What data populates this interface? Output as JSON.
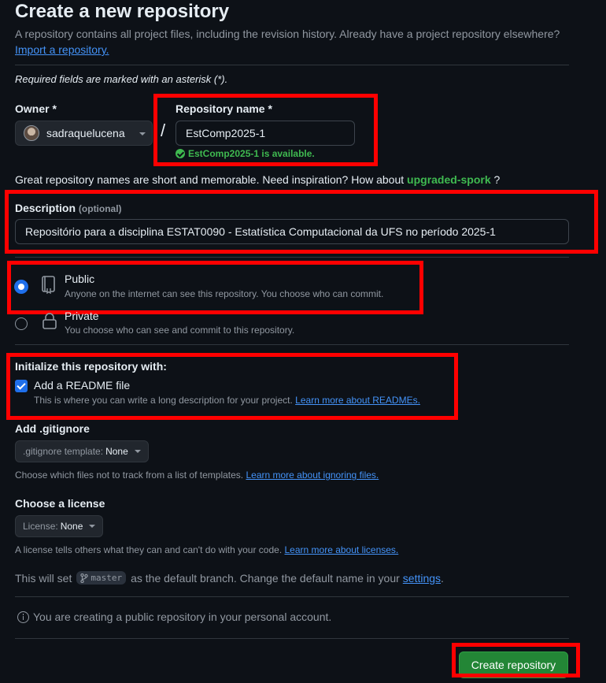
{
  "header": {
    "title": "Create a new repository",
    "subtitle": "A repository contains all project files, including the revision history. Already have a project repository elsewhere?",
    "import_link": "Import a repository."
  },
  "required_note": "Required fields are marked with an asterisk (*).",
  "owner": {
    "label": "Owner *",
    "value": "sadraquelucena",
    "avatar_icon": "user-avatar"
  },
  "separator": "/",
  "repo_name": {
    "label": "Repository name *",
    "value": "EstComp2025-1",
    "availability": "EstComp2025-1 is available.",
    "availability_color": "#3fb950"
  },
  "inspiration": {
    "text": "Great repository names are short and memorable. Need inspiration? How about",
    "suggestion": "upgraded-spork",
    "end": "?"
  },
  "description": {
    "label": "Description",
    "optional": "(optional)",
    "value": "Repositório para a disciplina ESTAT0090 - Estatística Computacional da UFS no período 2025-1"
  },
  "visibility": {
    "options": [
      {
        "label": "Public",
        "description": "Anyone on the internet can see this repository. You choose who can commit.",
        "icon": "repo-icon",
        "selected": true
      },
      {
        "label": "Private",
        "description": "You choose who can see and commit to this repository.",
        "icon": "lock-icon",
        "selected": false
      }
    ]
  },
  "initialize": {
    "heading": "Initialize this repository with:",
    "readme_label": "Add a README file",
    "readme_desc": "This is where you can write a long description for your project.",
    "readme_link": "Learn more about READMEs.",
    "readme_checked": true
  },
  "gitignore": {
    "heading": "Add .gitignore",
    "button_prefix": ".gitignore template:",
    "button_value": "None",
    "desc": "Choose which files not to track from a list of templates.",
    "link": "Learn more about ignoring files."
  },
  "license": {
    "heading": "Choose a license",
    "button_prefix": "License:",
    "button_value": "None",
    "desc": "A license tells others what they can and can't do with your code.",
    "link": "Learn more about licenses."
  },
  "branch": {
    "prefix": "This will set",
    "branch_name": "master",
    "suffix": "as the default branch. Change the default name in your",
    "settings_link": "settings",
    "end": "."
  },
  "info": "You are creating a public repository in your personal account.",
  "submit": "Create repository",
  "colors": {
    "accent_blue": "#1f6feb",
    "link_blue": "#4493f8",
    "success_green": "#238636",
    "highlight_red": "#ff0000"
  }
}
